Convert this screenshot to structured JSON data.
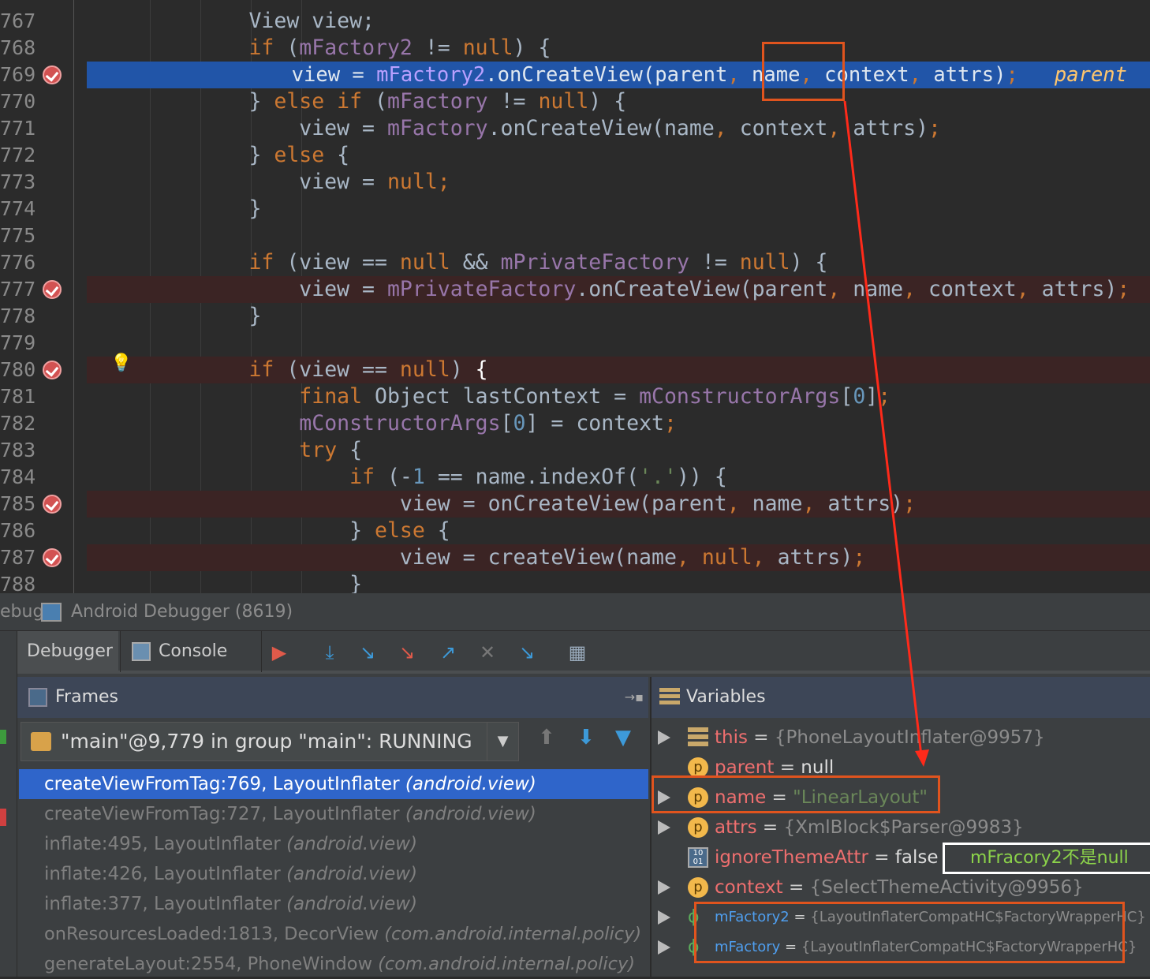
{
  "editor": {
    "lines": [
      {
        "no": "767",
        "tokens": [
          [
            "            View view;",
            ""
          ]
        ]
      },
      {
        "no": "768",
        "tokens": [
          [
            "            ",
            ""
          ],
          [
            "if",
            "k"
          ],
          [
            " (",
            ""
          ],
          [
            "mFactory2",
            "f"
          ],
          [
            " != ",
            ""
          ],
          [
            "null",
            "k"
          ],
          [
            ") {",
            ""
          ]
        ]
      },
      {
        "no": "769",
        "hl": true,
        "bp": true,
        "tokens": [
          [
            "                view = ",
            ""
          ],
          [
            "mFactory2",
            "f"
          ],
          [
            ".onCreateView(parent",
            ""
          ],
          [
            ",",
            "p"
          ],
          [
            " name",
            ""
          ],
          [
            ",",
            "p"
          ],
          [
            " context",
            ""
          ],
          [
            ",",
            "p"
          ],
          [
            " attrs)",
            ""
          ],
          [
            ";",
            "p"
          ],
          [
            "   ",
            ""
          ],
          [
            "parent",
            "i"
          ]
        ]
      },
      {
        "no": "770",
        "tokens": [
          [
            "            } ",
            ""
          ],
          [
            "else if",
            "k"
          ],
          [
            " (",
            ""
          ],
          [
            "mFactory",
            "f"
          ],
          [
            " != ",
            ""
          ],
          [
            "null",
            "k"
          ],
          [
            ") {",
            ""
          ]
        ]
      },
      {
        "no": "771",
        "tokens": [
          [
            "                view = ",
            ""
          ],
          [
            "mFactory",
            "f"
          ],
          [
            ".onCreateView(name",
            ""
          ],
          [
            ",",
            "p"
          ],
          [
            " context",
            ""
          ],
          [
            ",",
            "p"
          ],
          [
            " attrs)",
            ""
          ],
          [
            ";",
            "p"
          ]
        ]
      },
      {
        "no": "772",
        "tokens": [
          [
            "            } ",
            ""
          ],
          [
            "else",
            "k"
          ],
          [
            " {",
            ""
          ]
        ]
      },
      {
        "no": "773",
        "tokens": [
          [
            "                view = ",
            ""
          ],
          [
            "null",
            "k"
          ],
          [
            ";",
            "p"
          ]
        ]
      },
      {
        "no": "774",
        "tokens": [
          [
            "            }",
            ""
          ]
        ]
      },
      {
        "no": "775",
        "tokens": []
      },
      {
        "no": "776",
        "tokens": [
          [
            "            ",
            ""
          ],
          [
            "if",
            "k"
          ],
          [
            " (view == ",
            ""
          ],
          [
            "null",
            "k"
          ],
          [
            " && ",
            ""
          ],
          [
            "mPrivateFactory",
            "f"
          ],
          [
            " != ",
            ""
          ],
          [
            "null",
            "k"
          ],
          [
            ") {",
            ""
          ]
        ]
      },
      {
        "no": "777",
        "bp": true,
        "tokens": [
          [
            "                view = ",
            ""
          ],
          [
            "mPrivateFactory",
            "f"
          ],
          [
            ".onCreateView(parent",
            ""
          ],
          [
            ",",
            "p"
          ],
          [
            " name",
            ""
          ],
          [
            ",",
            "p"
          ],
          [
            " context",
            ""
          ],
          [
            ",",
            "p"
          ],
          [
            " attrs)",
            ""
          ],
          [
            ";",
            "p"
          ]
        ]
      },
      {
        "no": "778",
        "tokens": [
          [
            "            }",
            ""
          ]
        ]
      },
      {
        "no": "779",
        "tokens": []
      },
      {
        "no": "780",
        "bp": true,
        "tokens": [
          [
            "            ",
            ""
          ],
          [
            "if",
            "k"
          ],
          [
            " (view == ",
            ""
          ],
          [
            "null",
            "k"
          ],
          [
            ") ",
            ""
          ],
          [
            "{",
            "w"
          ]
        ]
      },
      {
        "no": "781",
        "tokens": [
          [
            "                ",
            ""
          ],
          [
            "final",
            "k"
          ],
          [
            " Object lastContext = ",
            ""
          ],
          [
            "mConstructorArgs",
            "f"
          ],
          [
            "[",
            ""
          ],
          [
            "0",
            "n"
          ],
          [
            "]",
            ""
          ],
          [
            ";",
            "p"
          ]
        ]
      },
      {
        "no": "782",
        "tokens": [
          [
            "                ",
            ""
          ],
          [
            "mConstructorArgs",
            "f"
          ],
          [
            "[",
            ""
          ],
          [
            "0",
            "n"
          ],
          [
            "] = context",
            ""
          ],
          [
            ";",
            "p"
          ]
        ]
      },
      {
        "no": "783",
        "tokens": [
          [
            "                ",
            ""
          ],
          [
            "try",
            "k"
          ],
          [
            " {",
            ""
          ]
        ]
      },
      {
        "no": "784",
        "tokens": [
          [
            "                    ",
            ""
          ],
          [
            "if",
            "k"
          ],
          [
            " (-",
            ""
          ],
          [
            "1",
            "n"
          ],
          [
            " == name.indexOf(",
            ""
          ],
          [
            "'.'",
            "s"
          ],
          [
            ")) {",
            ""
          ]
        ]
      },
      {
        "no": "785",
        "bp": true,
        "tokens": [
          [
            "                        view = onCreateView(parent",
            ""
          ],
          [
            ",",
            "p"
          ],
          [
            " name",
            ""
          ],
          [
            ",",
            "p"
          ],
          [
            " attrs)",
            ""
          ],
          [
            ";",
            "p"
          ]
        ]
      },
      {
        "no": "786",
        "tokens": [
          [
            "                    } ",
            ""
          ],
          [
            "else",
            "k"
          ],
          [
            " {",
            ""
          ]
        ]
      },
      {
        "no": "787",
        "bp": true,
        "tokens": [
          [
            "                        view = createView(name",
            ""
          ],
          [
            ",",
            "p"
          ],
          [
            " ",
            ""
          ],
          [
            "null",
            "k"
          ],
          [
            ",",
            "p"
          ],
          [
            " attrs)",
            ""
          ],
          [
            ";",
            "p"
          ]
        ]
      },
      {
        "no": "788",
        "tokens": [
          [
            "                    }",
            ""
          ]
        ]
      }
    ]
  },
  "debug": {
    "title_prefix": "ebug",
    "title": "Android Debugger (8619)",
    "tabs": {
      "debugger": "Debugger",
      "console": "Console"
    },
    "frames": {
      "header": "Frames",
      "thread": "\"main\"@9,779 in group \"main\": RUNNING",
      "rows": [
        {
          "method": "createViewFromTag:769, LayoutInflater ",
          "pkg": "(android.view)",
          "selected": true
        },
        {
          "method": "createViewFromTag:727, LayoutInflater ",
          "pkg": "(android.view)"
        },
        {
          "method": "inflate:495, LayoutInflater ",
          "pkg": "(android.view)"
        },
        {
          "method": "inflate:426, LayoutInflater ",
          "pkg": "(android.view)"
        },
        {
          "method": "inflate:377, LayoutInflater ",
          "pkg": "(android.view)"
        },
        {
          "method": "onResourcesLoaded:1813, DecorView ",
          "pkg": "(com.android.internal.policy)"
        },
        {
          "method": "generateLayout:2554, PhoneWindow ",
          "pkg": "(com.android.internal.policy)"
        }
      ]
    },
    "variables": {
      "header": "Variables",
      "rows": [
        {
          "name": "this",
          "eq": " = ",
          "value": "{PhoneLayoutInflater@9957}",
          "icon": "object-icon",
          "expand": true
        },
        {
          "name": "parent",
          "eq": " = ",
          "value": "null",
          "icon": "p",
          "expand": false,
          "vcolor": "#dddddd"
        },
        {
          "name": "name",
          "eq": " = ",
          "value": "\"LinearLayout\"",
          "icon": "p",
          "expand": true,
          "vcolor": "#6a8759"
        },
        {
          "name": "attrs",
          "eq": " = ",
          "value": "{XmlBlock$Parser@9983}",
          "icon": "p",
          "expand": true
        },
        {
          "name": "ignoreThemeAttr",
          "eq": " = ",
          "value": "false",
          "icon": "boolean-icon",
          "expand": false,
          "vcolor": "#dddddd"
        },
        {
          "name": "context",
          "eq": " = ",
          "value": "{SelectThemeActivity@9956}",
          "icon": "p",
          "expand": true
        },
        {
          "name": "mFactory2",
          "eq": " = ",
          "value": "{LayoutInflaterCompatHC$FactoryWrapperHC}",
          "icon": "field-icon",
          "expand": true,
          "blue": true
        },
        {
          "name": "mFactory",
          "eq": " = ",
          "value": "{LayoutInflaterCompatHC$FactoryWrapperHC}",
          "icon": "field-icon",
          "expand": true,
          "blue": true
        }
      ]
    }
  },
  "annotation": {
    "note": "mFracory2不是null",
    "box_color": "#e0541e",
    "arrow_color": "#ff2a1a"
  }
}
